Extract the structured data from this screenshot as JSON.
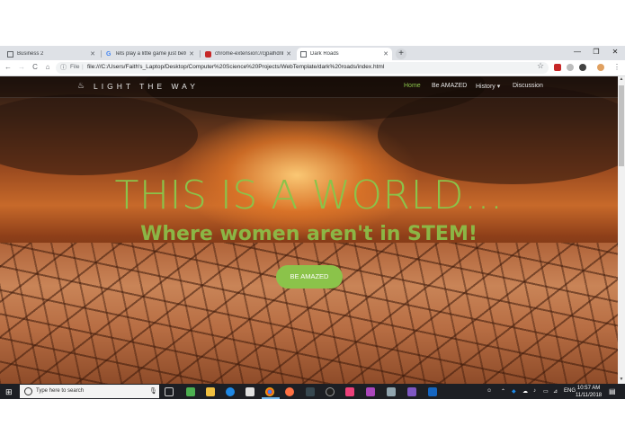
{
  "browser": {
    "tabs": [
      {
        "title": "Business 2",
        "active": false
      },
      {
        "title": "lets play a little game just betwe",
        "active": false
      },
      {
        "title": "chrome-extension://cjpalhdnbp",
        "active": false
      },
      {
        "title": "Dark Roads",
        "active": true
      }
    ],
    "new_tab": "+",
    "window_controls": {
      "minimize": "—",
      "maximize": "❐",
      "close": "✕"
    },
    "nav": {
      "back": "←",
      "forward": "→",
      "reload": "C",
      "home": "⌂"
    },
    "address": {
      "info_icon": "ⓘ",
      "scheme_label": "File",
      "separator": "|",
      "url": "file:///C:/Users/Faith's_Laptop/Desktop/Computer%20Science%20Projects/WebTemplate/dark%20roads/index.html"
    },
    "star_icon": "☆",
    "menu_icon": "⋮"
  },
  "site": {
    "brand": "LIGHT THE WAY",
    "brand_icon": "flame-icon",
    "nav": [
      {
        "label": "Home",
        "active": true
      },
      {
        "label": "Be AMAZED",
        "active": false
      },
      {
        "label": "History ▾",
        "active": false
      },
      {
        "label": "Discussion",
        "active": false
      }
    ],
    "hero_title": "THIS IS A WORLD...",
    "hero_subtitle": "Where women aren't in STEM!",
    "cta_label": "BE AMAZED",
    "accent_color": "#8bc34a"
  },
  "taskbar": {
    "search_placeholder": "Type here to search",
    "tray_lang": "ENG",
    "time": "10:57 AM",
    "date": "11/11/2018"
  }
}
